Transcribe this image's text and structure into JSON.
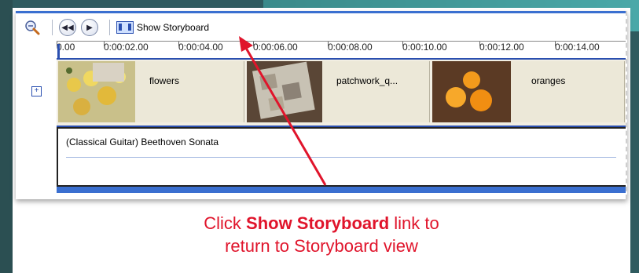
{
  "toolbar": {
    "zoom_icon": "zoom-out-icon",
    "prev_icon": "rewind-icon",
    "play_icon": "play-icon",
    "storyboard_label": "Show Storyboard"
  },
  "timeline": {
    "ruler_ticks": [
      "0.00",
      "0:00:02.00",
      "0:00:04.00",
      "0:00:06.00",
      "0:00:08.00",
      "0:00:10.00",
      "0:00:12.00",
      "0:00:14.00"
    ],
    "video_clips": [
      {
        "label": "flowers"
      },
      {
        "label": "patchwork_q..."
      },
      {
        "label": "oranges"
      }
    ],
    "audio_clip": {
      "label": "(Classical Guitar) Beethoven Sonata"
    }
  },
  "caption": {
    "prefix": "Click ",
    "bold": "Show Storyboard",
    "suffix": " link to",
    "line2": "return to Storyboard view"
  },
  "colors": {
    "accent_blue": "#2a4fb0",
    "caption_red": "#e0142b",
    "arrow_red": "#e0142b"
  }
}
